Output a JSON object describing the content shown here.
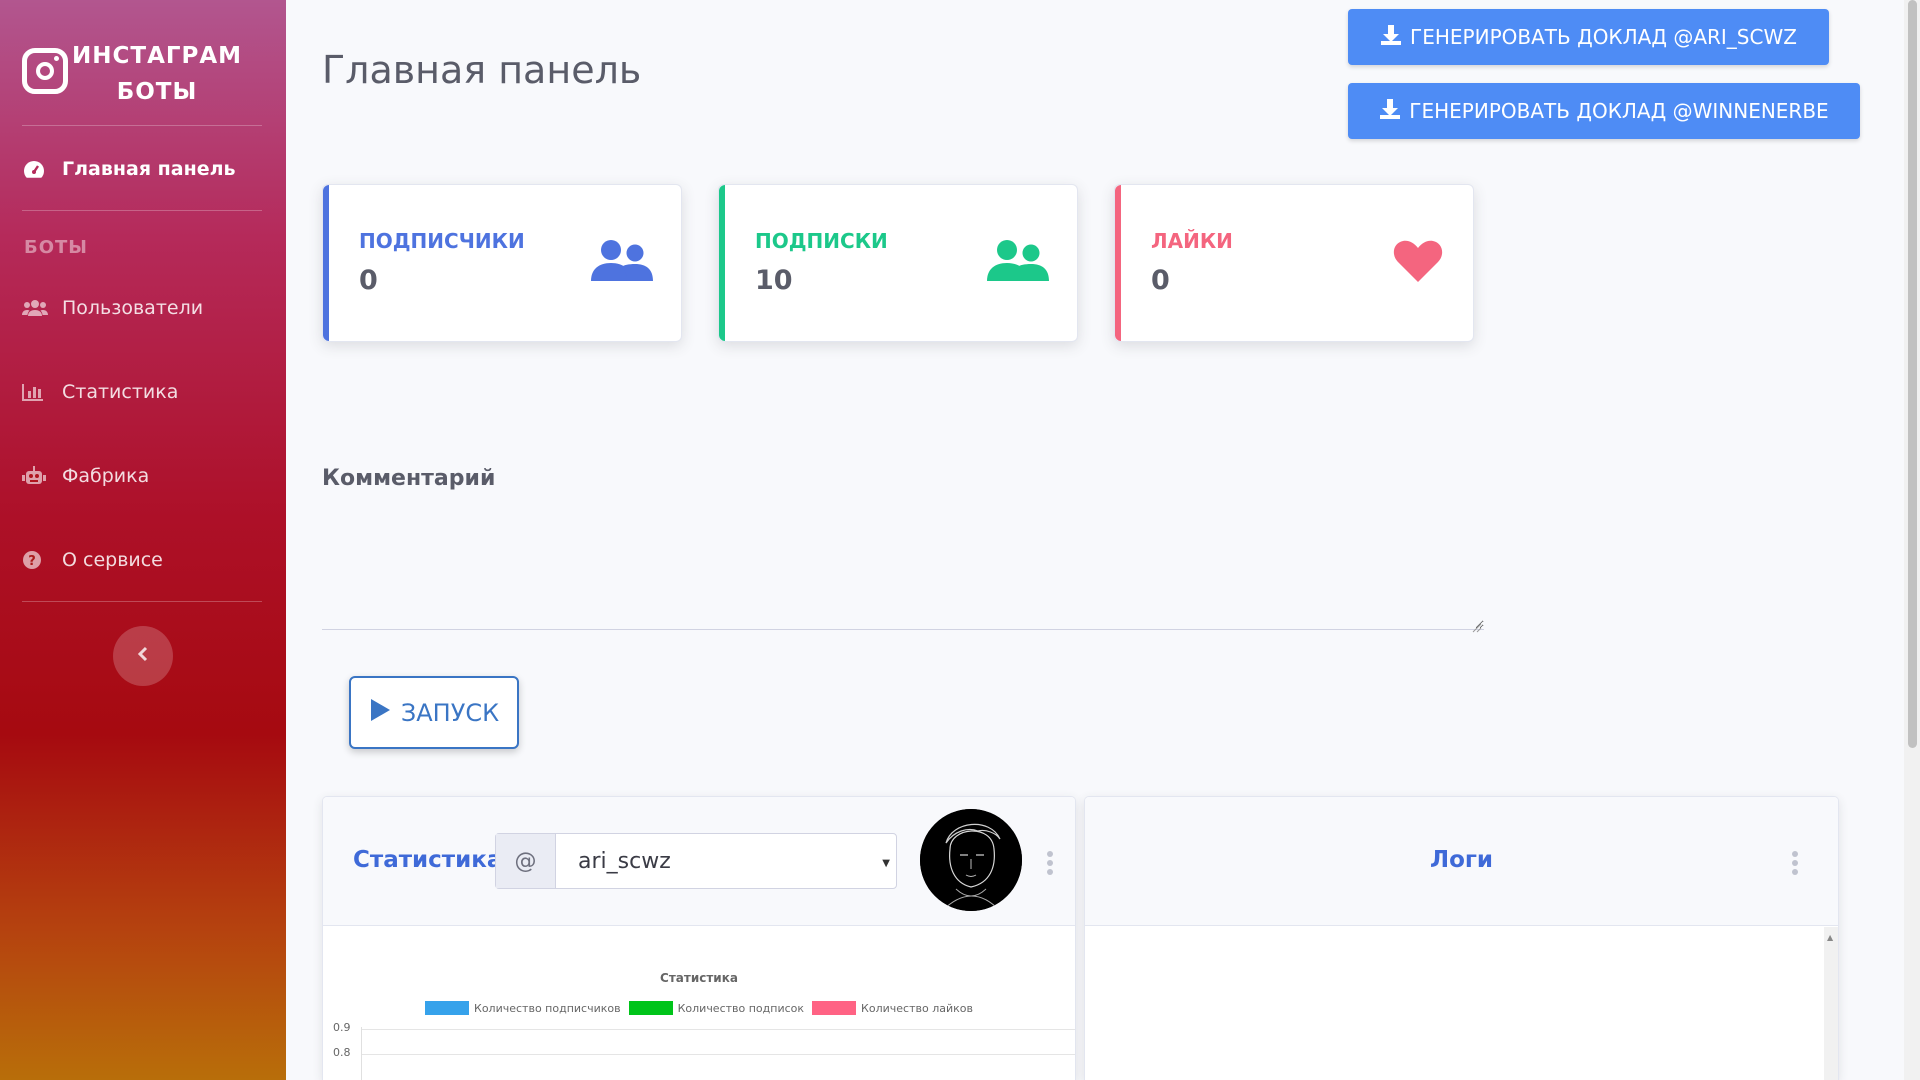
{
  "sidebar": {
    "brand_line1": "ИНСТАГРАМ",
    "brand_line2": "БОТЫ",
    "dashboard": "Главная панель",
    "section_heading": "БОТЫ",
    "items": [
      {
        "label": "Пользователи",
        "icon": "users-icon"
      },
      {
        "label": "Статистика",
        "icon": "chart-bar-icon"
      },
      {
        "label": "Фабрика",
        "icon": "robot-icon"
      },
      {
        "label": "О сервисе",
        "icon": "question-circle-icon"
      }
    ]
  },
  "header": {
    "title": "Главная панель",
    "report_button_1": "ГЕНЕРИРОВАТЬ ДОКЛАД @ARI_SCWZ",
    "report_button_2": "ГЕНЕРИРОВАТЬ ДОКЛАД @WINNENERBE"
  },
  "cards": [
    {
      "label": "ПОДПИСЧИКИ",
      "value": "0",
      "color": "#4e73df",
      "icon": "users-icon"
    },
    {
      "label": "ПОДПИСКИ",
      "value": "10",
      "color": "#1cc88a",
      "icon": "users-icon"
    },
    {
      "label": "ЛАЙКИ",
      "value": "0",
      "color": "#f4657f",
      "icon": "heart-icon"
    }
  ],
  "comment": {
    "label": "Комментарий",
    "value": ""
  },
  "run_button": "ЗАПУСК",
  "stats_panel": {
    "title": "Статистика",
    "at_prefix": "@",
    "selected_account": "ari_scwz"
  },
  "logs_panel": {
    "title": "Логи"
  },
  "chart_data": {
    "type": "line",
    "title": "Статистика",
    "series": [
      {
        "name": "Количество подписчиков",
        "color": "#36a2eb",
        "values": []
      },
      {
        "name": "Количество подписок",
        "color": "#00c41a",
        "values": []
      },
      {
        "name": "Количество лайков",
        "color": "#ff6384",
        "values": []
      }
    ],
    "y_ticks": [
      "0.9",
      "0.8"
    ]
  }
}
